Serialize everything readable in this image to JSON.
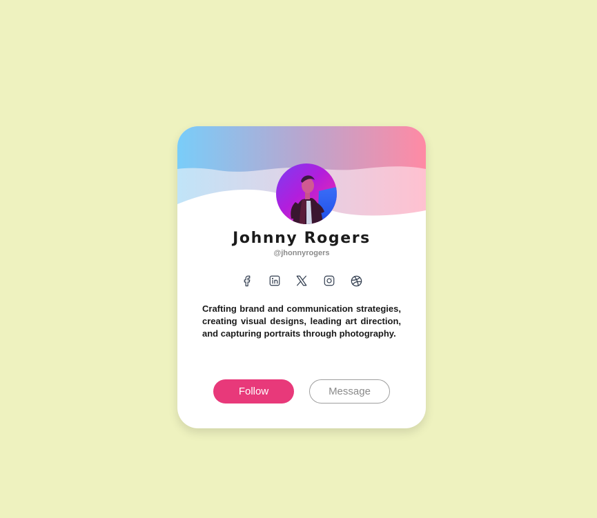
{
  "profile": {
    "name": "Johnny Rogers",
    "handle": "@jhonnyrogers",
    "bio": "Crafting brand and communication strategies, creating visual designs, leading art direction, and capturing portraits through photography."
  },
  "socials": [
    {
      "icon": "facebook-icon"
    },
    {
      "icon": "linkedin-icon"
    },
    {
      "icon": "x-icon"
    },
    {
      "icon": "instagram-icon"
    },
    {
      "icon": "dribbble-icon"
    }
  ],
  "actions": {
    "follow_label": "Follow",
    "message_label": "Message"
  },
  "colors": {
    "background": "#eef2bf",
    "accent": "#e8397a",
    "gradient_start": "#79cdf9",
    "gradient_end": "#ff8aa4",
    "icon_stroke": "#2f3b4d"
  }
}
